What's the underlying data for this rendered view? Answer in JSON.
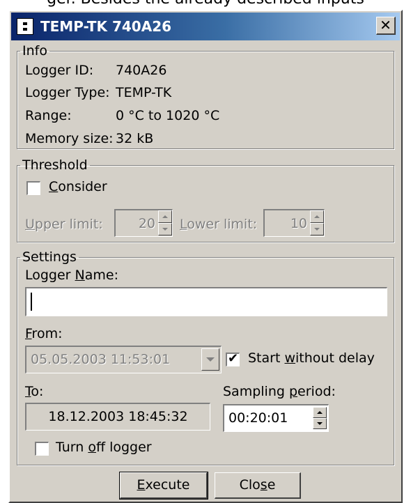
{
  "top_caption": "ger. Besides the already described inputs",
  "window": {
    "title": "TEMP-TK 740A26",
    "close_glyph": "✕"
  },
  "info": {
    "legend": "Info",
    "rows": [
      {
        "label": "Logger ID:",
        "value": "740A26"
      },
      {
        "label": "Logger Type:",
        "value": "TEMP-TK"
      },
      {
        "label": "Range:",
        "value": "0 °C to 1020 °C"
      },
      {
        "label": "Memory size:",
        "value": "32 kB"
      }
    ]
  },
  "threshold": {
    "legend": "Threshold",
    "consider": {
      "pre": "",
      "accel": "C",
      "post": "onsider",
      "checked": false
    },
    "upper": {
      "accel": "U",
      "post": "pper limit:",
      "value": "20"
    },
    "lower": {
      "accel": "L",
      "post": "ower limit:",
      "value": "10"
    }
  },
  "settings": {
    "legend": "Settings",
    "logger_name": {
      "pre": "Logger ",
      "accel": "N",
      "post": "ame:",
      "value": ""
    },
    "from": {
      "accel": "F",
      "post": "rom:",
      "value": "05.05.2003 11:53:01"
    },
    "start_without_delay": {
      "pre": "Start ",
      "accel": "w",
      "post": "ithout delay",
      "checked": true
    },
    "to": {
      "accel": "T",
      "post": "o:",
      "value": "18.12.2003 18:45:32"
    },
    "sampling": {
      "pre": "Sampling ",
      "accel": "p",
      "post": "eriod:",
      "value": "00:20:01"
    },
    "turn_off": {
      "pre": "Turn ",
      "accel": "o",
      "post": "ff logger",
      "checked": false
    }
  },
  "buttons": {
    "execute": {
      "pre": "",
      "accel": "E",
      "post": "xecute"
    },
    "close": {
      "pre": "Clo",
      "accel": "s",
      "post": "e"
    }
  }
}
